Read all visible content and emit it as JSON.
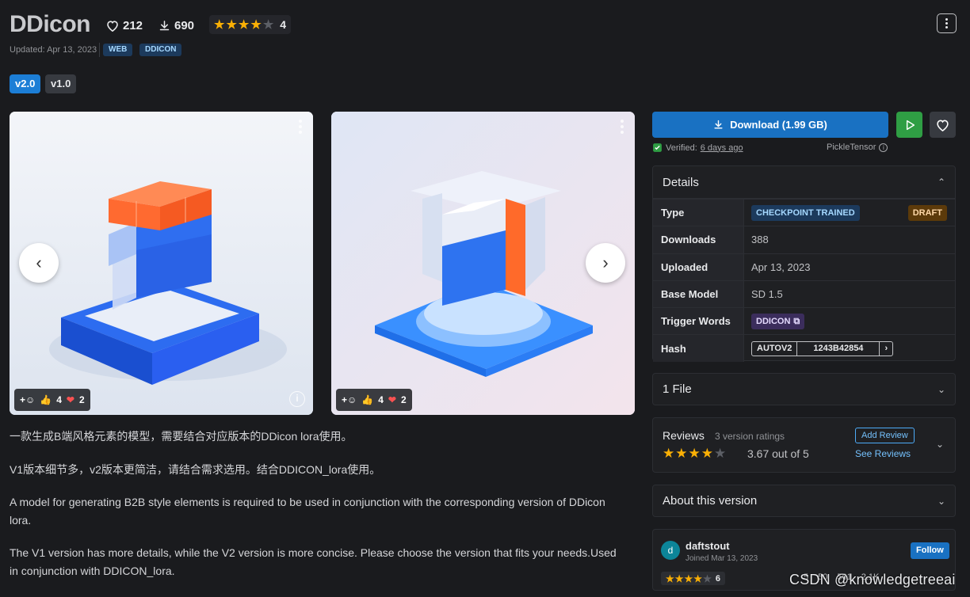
{
  "header": {
    "title": "DDicon",
    "likes": "212",
    "downloads": "690",
    "rating_count": "4",
    "rating_stars": 4,
    "updated": "Updated: Apr 13, 2023",
    "tags": [
      "WEB",
      "DDICON"
    ],
    "icons": {
      "likes": "heart-icon",
      "downloads": "download-icon",
      "menu": "kebab-menu-icon"
    }
  },
  "versions": [
    "v2.0",
    "v1.0"
  ],
  "gallery": {
    "images": [
      {
        "reaction_likes": "4",
        "reaction_hearts": "2"
      },
      {
        "reaction_likes": "4",
        "reaction_hearts": "2"
      }
    ]
  },
  "description": [
    "一款生成B端风格元素的模型，需要结合对应版本的DDicon lora使用。",
    "V1版本细节多，v2版本更简洁，请结合需求选用。结合DDICON_lora使用。",
    "A model for generating B2B style elements is required to be used in conjunction with the corresponding version of DDicon lora.",
    "The V1 version has more details, while the V2 version is more concise. Please choose the version that fits your needs.Used in conjunction with DDICON_lora."
  ],
  "sidebar": {
    "download_label": "Download (1.99 GB)",
    "verified_label": "Verified:",
    "verified_when": "6 days ago",
    "pickle_label": "PickleTensor",
    "details": {
      "title": "Details",
      "type_label": "Type",
      "type_value": "CHECKPOINT TRAINED",
      "type_status": "DRAFT",
      "downloads_label": "Downloads",
      "downloads_value": "388",
      "uploaded_label": "Uploaded",
      "uploaded_value": "Apr 13, 2023",
      "base_label": "Base Model",
      "base_value": "SD 1.5",
      "trigger_label": "Trigger Words",
      "trigger_value": "DDICON",
      "hash_label": "Hash",
      "hash_algo": "AUTOV2",
      "hash_value": "1243B42854"
    },
    "files_label": "1 File",
    "reviews": {
      "title": "Reviews",
      "count": "3 version ratings",
      "score": "3.67 out of 5",
      "stars": 3.67,
      "add_label": "Add Review",
      "see_label": "See Reviews"
    },
    "about_label": "About this version",
    "creator": {
      "avatar_letter": "d",
      "name": "daftstout",
      "joined": "Joined Mar 13, 2023",
      "follow_label": "Follow",
      "rating_count": "6",
      "stats": [
        "5",
        "50",
        "561",
        "2.1K"
      ]
    }
  },
  "colors": {
    "background": "#1a1b1e",
    "primary": "#1971c2",
    "success": "#2f9e44",
    "star": "#fab005"
  },
  "watermark": "CSDN @knowledgetreeai"
}
